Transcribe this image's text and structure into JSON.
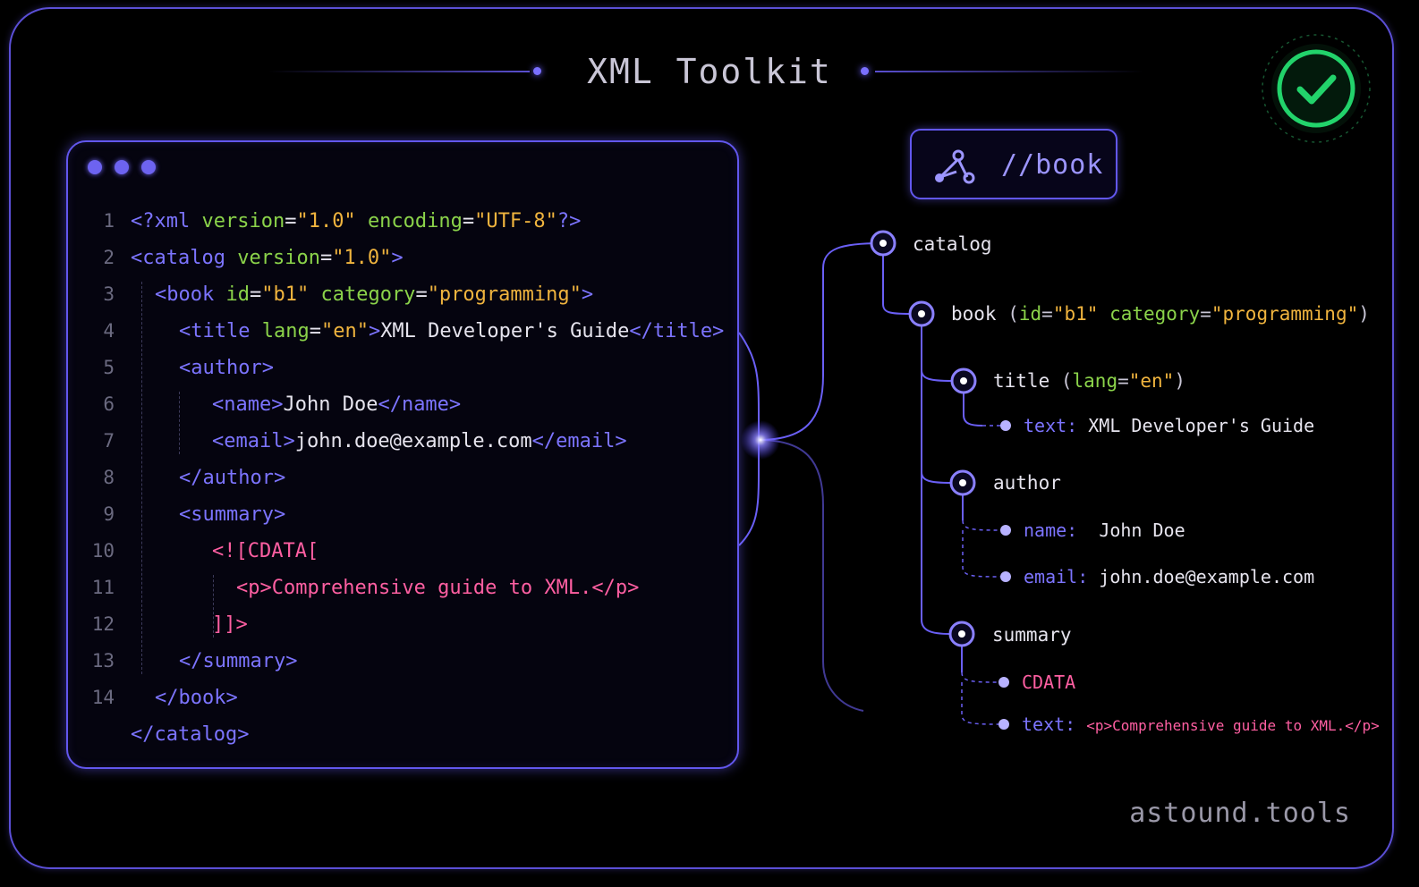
{
  "header": {
    "title": "XML Toolkit"
  },
  "status": {
    "icon": "check-icon",
    "color": "#22d36b"
  },
  "editor": {
    "lines": [
      {
        "n": "1",
        "indent": 0,
        "parts": [
          [
            "t",
            "<?xml "
          ],
          [
            "a",
            "version"
          ],
          [
            "w",
            "="
          ],
          [
            "v",
            "\"1.0\""
          ],
          [
            "w",
            " "
          ],
          [
            "a",
            "encoding"
          ],
          [
            "w",
            "="
          ],
          [
            "v",
            "\"UTF-8\""
          ],
          [
            "t",
            "?>"
          ]
        ]
      },
      {
        "n": "2",
        "indent": 0,
        "parts": [
          [
            "t",
            "<catalog "
          ],
          [
            "a",
            "version"
          ],
          [
            "w",
            "="
          ],
          [
            "v",
            "\"1.0\""
          ],
          [
            "t",
            ">"
          ]
        ]
      },
      {
        "n": "3",
        "indent": 1,
        "parts": [
          [
            "t",
            "<book "
          ],
          [
            "a",
            "id"
          ],
          [
            "w",
            "="
          ],
          [
            "v",
            "\"b1\""
          ],
          [
            "w",
            " "
          ],
          [
            "a",
            "category"
          ],
          [
            "w",
            "="
          ],
          [
            "v",
            "\"programming\""
          ],
          [
            "t",
            ">"
          ]
        ]
      },
      {
        "n": "4",
        "indent": 2,
        "parts": [
          [
            "t",
            "<title "
          ],
          [
            "a",
            "lang"
          ],
          [
            "w",
            "="
          ],
          [
            "v",
            "\"en\""
          ],
          [
            "t",
            ">"
          ],
          [
            "w",
            "XML Developer's Guide"
          ],
          [
            "t",
            "</title>"
          ]
        ]
      },
      {
        "n": "5",
        "indent": 2,
        "parts": [
          [
            "t",
            "<author>"
          ]
        ]
      },
      {
        "n": "6",
        "indent": 3,
        "parts": [
          [
            "t",
            "<name>"
          ],
          [
            "w",
            "John Doe"
          ],
          [
            "t",
            "</name>"
          ]
        ]
      },
      {
        "n": "7",
        "indent": 3,
        "parts": [
          [
            "t",
            "<email>"
          ],
          [
            "w",
            "john.doe@example.com"
          ],
          [
            "t",
            "</email>"
          ]
        ]
      },
      {
        "n": "8",
        "indent": 2,
        "parts": [
          [
            "t",
            "</author>"
          ]
        ]
      },
      {
        "n": "9",
        "indent": 2,
        "parts": [
          [
            "t",
            "<summary>"
          ]
        ]
      },
      {
        "n": "10",
        "indent": 3,
        "parts": [
          [
            "p",
            "<![CDATA["
          ]
        ]
      },
      {
        "n": "11",
        "indent": 4,
        "parts": [
          [
            "p",
            "<p>Comprehensive guide to XML.</p>"
          ]
        ]
      },
      {
        "n": "12",
        "indent": 3,
        "parts": [
          [
            "p",
            "]]>"
          ]
        ]
      },
      {
        "n": "13",
        "indent": 2,
        "parts": [
          [
            "t",
            "</summary>"
          ]
        ]
      },
      {
        "n": "14",
        "indent": 1,
        "parts": [
          [
            "t",
            "</book>"
          ]
        ]
      },
      {
        "n": "",
        "indent": 0,
        "parts": [
          [
            "t",
            "</catalog>"
          ]
        ]
      }
    ]
  },
  "xpath": {
    "query": "//book",
    "icon": "graph-node-icon"
  },
  "tree": {
    "catalog": "catalog",
    "book": {
      "name": "book",
      "attrs": [
        [
          "g",
          " ("
        ],
        [
          "a",
          "id"
        ],
        [
          "g",
          "="
        ],
        [
          "v",
          "\"b1\""
        ],
        [
          "g",
          " "
        ],
        [
          "a",
          "category"
        ],
        [
          "g",
          "="
        ],
        [
          "v",
          "\"programming\""
        ],
        [
          "g",
          ")"
        ]
      ]
    },
    "title": {
      "name": "title",
      "attrs": [
        [
          "g",
          " ("
        ],
        [
          "a",
          "lang"
        ],
        [
          "g",
          "="
        ],
        [
          "v",
          "\"en\""
        ],
        [
          "g",
          ")"
        ]
      ]
    },
    "title_text": {
      "key": "text:",
      "value": "XML Developer's Guide"
    },
    "author": "author",
    "name": {
      "key": "name:",
      "value": "John Doe"
    },
    "email": {
      "key": "email:",
      "value": "john.doe@example.com"
    },
    "summary": "summary",
    "cdata": "CDATA",
    "summary_text": {
      "key": "text:",
      "value": "<p>Comprehensive guide to XML.</p>"
    }
  },
  "brand": "astound.tools",
  "colors": {
    "tag": "#7c74ff",
    "attr": "#8bd34a",
    "value": "#f0b43e",
    "cdata": "#ff5fa2",
    "accent": "#6257ee"
  }
}
